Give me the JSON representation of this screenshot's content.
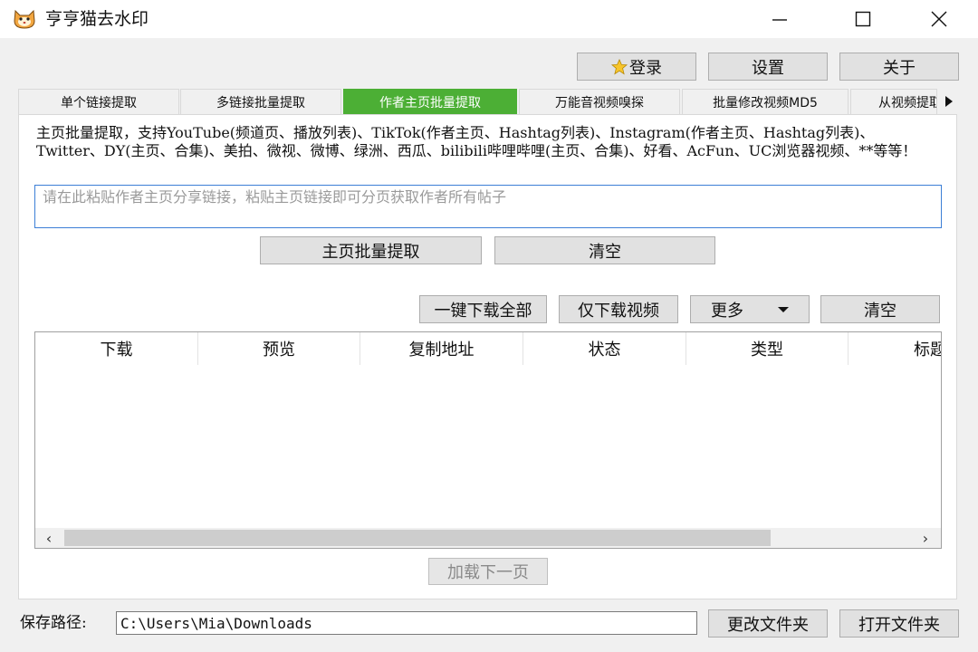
{
  "window": {
    "title": "亨亨猫去水印"
  },
  "toolbar": {
    "login": "登录",
    "settings": "设置",
    "about": "关于"
  },
  "tabs": [
    {
      "label": "单个链接提取"
    },
    {
      "label": "多链接批量提取"
    },
    {
      "label": "作者主页批量提取"
    },
    {
      "label": "万能音视频嗅探"
    },
    {
      "label": "批量修改视频MD5"
    },
    {
      "label": "从视频提取音"
    }
  ],
  "main": {
    "description": "主页批量提取，支持YouTube(频道页、播放列表)、TikTok(作者主页、Hashtag列表)、Instagram(作者主页、Hashtag列表)、Twitter、DY(主页、合集)、美拍、微视、微博、绿洲、西瓜、bilibili哔哩哔哩(主页、合集)、好看、AcFun、UC浏览器视频、**等等！",
    "url_placeholder": "请在此粘贴作者主页分享链接，粘贴主页链接即可分页获取作者所有帖子",
    "url_value": "",
    "extract_button": "主页批量提取",
    "clear_button": "清空"
  },
  "actions": {
    "download_all": "一键下载全部",
    "download_video_only": "仅下载视频",
    "more": "更多",
    "clear": "清空"
  },
  "grid": {
    "columns": [
      "下载",
      "预览",
      "复制地址",
      "状态",
      "类型",
      "标题"
    ]
  },
  "load_next": "加载下一页",
  "footer": {
    "save_label": "保存路径:",
    "save_path": "C:\\Users\\Mia\\Downloads",
    "change_folder": "更改文件夹",
    "open_folder": "打开文件夹"
  },
  "colors": {
    "active_tab": "#4caf35",
    "input_focus": "#3c7fd6"
  },
  "icons": [
    "cat-logo-icon",
    "minimize-icon",
    "maximize-icon",
    "close-icon",
    "star-icon",
    "dropdown-arrow-icon",
    "tab-scroll-right-icon",
    "scroll-left-icon",
    "scroll-right-icon"
  ]
}
